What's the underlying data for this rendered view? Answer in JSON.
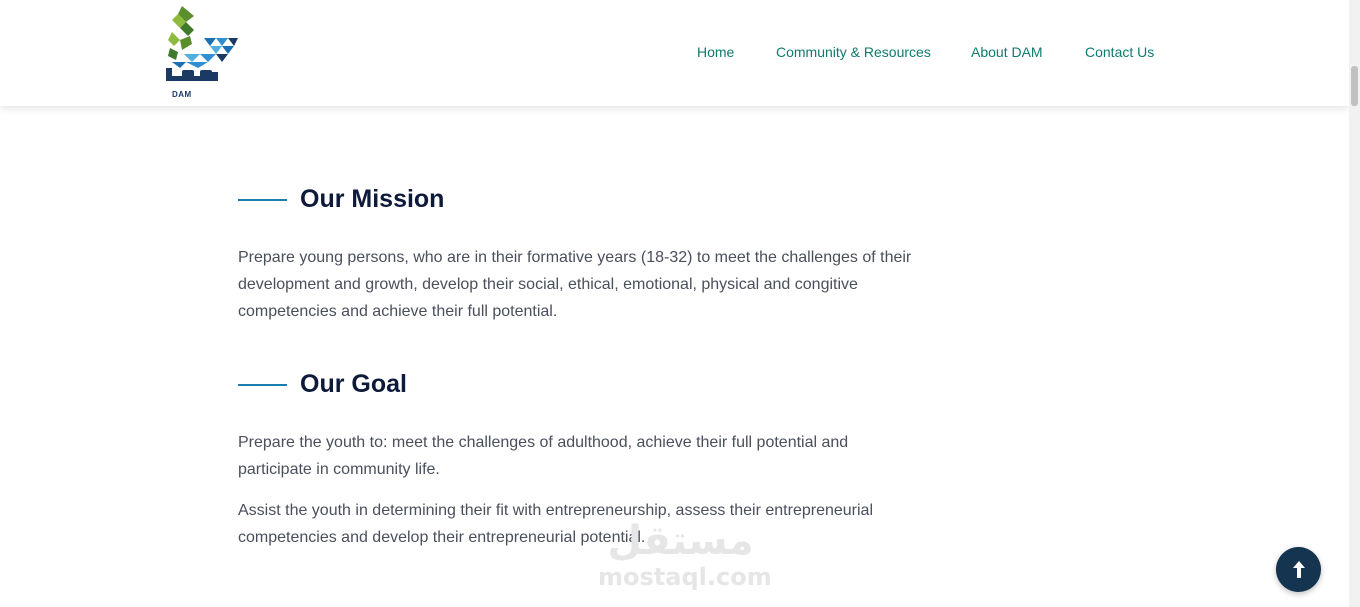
{
  "header": {
    "logo_caption": "DAM",
    "nav": [
      {
        "label": "Home"
      },
      {
        "label": "Community & Resources"
      },
      {
        "label": "About DAM"
      },
      {
        "label": "Contact Us"
      }
    ]
  },
  "mission": {
    "title": "Our Mission",
    "text": "Prepare young persons, who are in their formative years (18-32) to meet the challenges of their development and growth, develop their social, ethical, emotional, physical and congitive competencies and achieve their full potential."
  },
  "goal": {
    "title": "Our Goal",
    "paragraphs": [
      "Prepare the youth to: meet the challenges of adulthood, achieve their full potential and participate in community life.",
      "Assist the youth in determining their fit with entrepreneurship, assess their entrepreneurial competencies and develop their entrepreneurial potential."
    ]
  },
  "watermark": {
    "arabic": "مستقل",
    "latin": "mostaql.com"
  },
  "back_to_top": {
    "icon": "arrow-up-icon"
  },
  "colors": {
    "nav_link": "#0f7a6e",
    "heading": "#0e1a3a",
    "accent_line": "#1a7fb0",
    "body_text": "#4a4f5c",
    "back_to_top_bg": "#15344f"
  }
}
